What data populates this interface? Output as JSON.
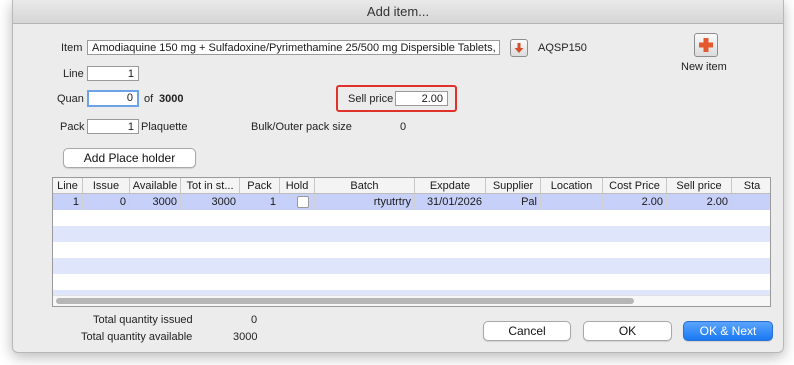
{
  "dialog": {
    "title": "Add item..."
  },
  "item": {
    "label": "Item",
    "value": "Amodiaquine 150 mg + Sulfadoxine/Pyrimethamine 25/500 mg Dispersible Tablets,",
    "code": "AQSP150",
    "icons": {
      "lookup": "down-arrow-icon",
      "new_item": "plus-cross-icon"
    }
  },
  "new_item": {
    "label": "New item"
  },
  "line": {
    "label": "Line",
    "value": "1"
  },
  "quan": {
    "label": "Quan",
    "value": "0",
    "of_label": "of",
    "total": "3000"
  },
  "sell_price": {
    "label": "Sell price",
    "value": "2.00",
    "highlight_color": "#e0312b"
  },
  "pack": {
    "label": "Pack",
    "value": "1",
    "unit": "Plaquette"
  },
  "bulk": {
    "label": "Bulk/Outer pack size",
    "value": "0"
  },
  "placeholder_button": {
    "label": "Add Place holder"
  },
  "table": {
    "columns": [
      "Line",
      "Issue",
      "Available",
      "Tot in st...",
      "Pack",
      "Hold",
      "Batch",
      "Expdate",
      "Supplier",
      "Location",
      "Cost Price",
      "Sell price",
      "Sta"
    ],
    "rows": [
      {
        "line": "1",
        "issue": "0",
        "available": "3000",
        "tot_in_stock": "3000",
        "pack": "1",
        "hold": false,
        "batch": "rtyutrtry",
        "expdate": "31/01/2026",
        "supplier": "Pal",
        "location": "",
        "cost_price": "2.00",
        "sell_price": "2.00",
        "status": ""
      }
    ],
    "selected_row_color": "#c7d0f8",
    "alt_row_color": "#dfe5fb"
  },
  "totals": {
    "issued_label": "Total quantity issued",
    "issued_value": "0",
    "available_label": "Total quantity available",
    "available_value": "3000"
  },
  "buttons": {
    "cancel": "Cancel",
    "ok": "OK",
    "ok_next": "OK & Next",
    "accent": "#1a78f2"
  }
}
